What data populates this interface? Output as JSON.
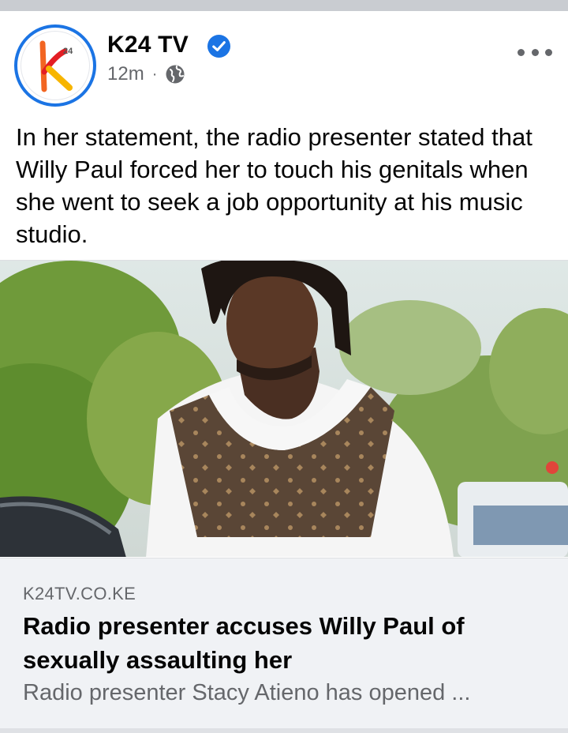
{
  "post": {
    "page_name": "K24 TV",
    "verified": true,
    "timestamp": "12m",
    "separator": "·",
    "audience_icon": "globe-icon",
    "avatar_logo_text": "24",
    "more_icon": "more-options-icon",
    "text": "In her statement, the radio presenter stated that Willy Paul forced her to touch his genitals when she went to seek a job opportunity at his music studio."
  },
  "link_preview": {
    "domain": "K24TV.CO.KE",
    "title": "Radio presenter accuses Willy Paul of sexually assaulting her",
    "description": "Radio presenter Stacy Atieno has opened ..."
  },
  "colors": {
    "verified_blue": "#1b74e4",
    "secondary_text": "#65676b",
    "card_background": "#f0f2f5",
    "logo_orange": "#f26522",
    "logo_red": "#e31e24",
    "logo_yellow": "#f7b500"
  }
}
